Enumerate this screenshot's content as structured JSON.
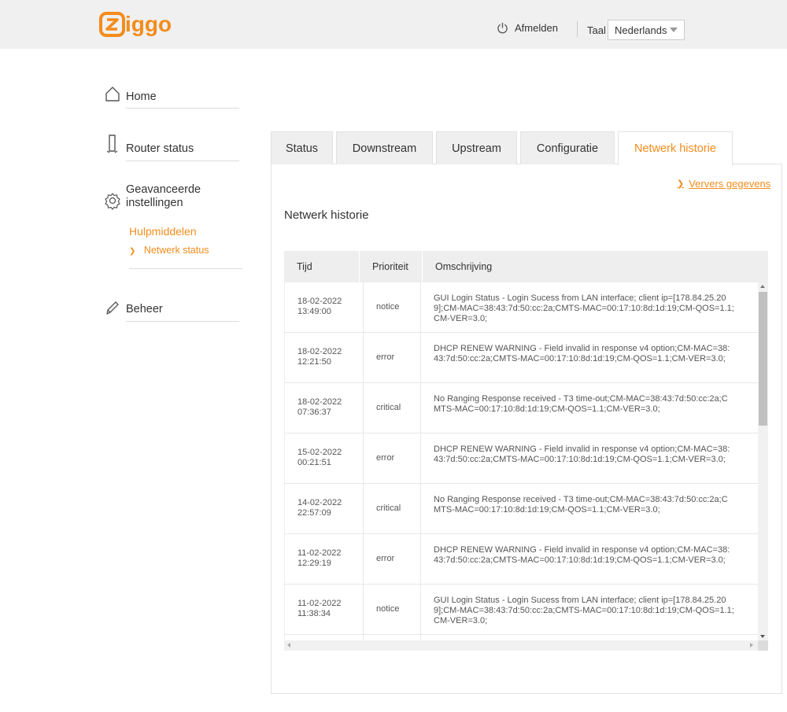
{
  "header": {
    "logo_text": "ziggo",
    "logout_label": "Afmelden",
    "language_label": "Taal",
    "language_value": "Nederlands"
  },
  "sidebar": {
    "home_label": "Home",
    "router_status_label": "Router status",
    "advanced_label_1": "Geavanceerde",
    "advanced_label_2": "instellingen",
    "tools_label": "Hulpmiddelen",
    "network_status_label": "Netwerk status",
    "manage_label": "Beheer"
  },
  "tabs": [
    {
      "label": "Status"
    },
    {
      "label": "Downstream"
    },
    {
      "label": "Upstream"
    },
    {
      "label": "Configuratie"
    },
    {
      "label": "Netwerk historie"
    }
  ],
  "main": {
    "refresh_label": "Ververs gegevens",
    "title": "Netwerk historie"
  },
  "table": {
    "headers": {
      "time": "Tijd",
      "priority": "Prioriteit",
      "description": "Omschrijving"
    },
    "rows": [
      {
        "date": "18-02-2022",
        "time": "13:49:00",
        "priority": "notice",
        "desc": "GUI Login Status - Login Sucess from LAN interface; client ip=[178.84.25.209];CM-MAC=38:43:7d:50:cc:2a;CMTS-MAC=00:17:10:8d:1d:19;CM-QOS=1.1;CM-VER=3.0;"
      },
      {
        "date": "18-02-2022",
        "time": "12:21:50",
        "priority": "error",
        "desc": "DHCP RENEW WARNING - Field invalid in response v4 option;CM-MAC=38:43:7d:50:cc:2a;CMTS-MAC=00:17:10:8d:1d:19;CM-QOS=1.1;CM-VER=3.0;"
      },
      {
        "date": "18-02-2022",
        "time": "07:36:37",
        "priority": "critical",
        "desc": "No Ranging Response received - T3 time-out;CM-MAC=38:43:7d:50:cc:2a;CMTS-MAC=00:17:10:8d:1d:19;CM-QOS=1.1;CM-VER=3.0;"
      },
      {
        "date": "15-02-2022",
        "time": "00:21:51",
        "priority": "error",
        "desc": "DHCP RENEW WARNING - Field invalid in response v4 option;CM-MAC=38:43:7d:50:cc:2a;CMTS-MAC=00:17:10:8d:1d:19;CM-QOS=1.1;CM-VER=3.0;"
      },
      {
        "date": "14-02-2022",
        "time": "22:57:09",
        "priority": "critical",
        "desc": "No Ranging Response received - T3 time-out;CM-MAC=38:43:7d:50:cc:2a;CMTS-MAC=00:17:10:8d:1d:19;CM-QOS=1.1;CM-VER=3.0;"
      },
      {
        "date": "11-02-2022",
        "time": "12:29:19",
        "priority": "error",
        "desc": "DHCP RENEW WARNING - Field invalid in response v4 option;CM-MAC=38:43:7d:50:cc:2a;CMTS-MAC=00:17:10:8d:1d:19;CM-QOS=1.1;CM-VER=3.0;"
      },
      {
        "date": "11-02-2022",
        "time": "11:38:34",
        "priority": "notice",
        "desc": "GUI Login Status - Login Sucess from LAN interface; client ip=[178.84.25.209];CM-MAC=38:43:7d:50:cc:2a;CMTS-MAC=00:17:10:8d:1d:19;CM-QOS=1.1;CM-VER=3.0;"
      }
    ]
  },
  "colors": {
    "accent": "#f48c1c",
    "header_bg": "#f0f0f0"
  },
  "icons": [
    "power-icon",
    "home-icon",
    "router-icon",
    "gear-icon",
    "chevron-right-icon",
    "pencil-icon"
  ]
}
